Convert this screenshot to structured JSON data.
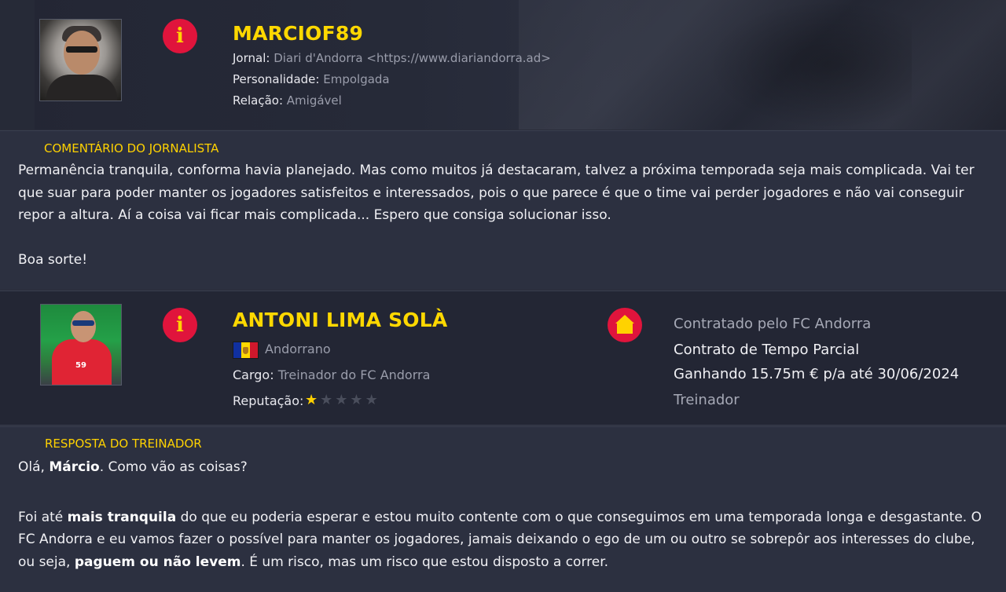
{
  "journalist": {
    "name": "MARCIOF89",
    "newspaper_label": "Jornal:",
    "newspaper_value": "Diari d'Andorra <https://www.diariandorra.ad>",
    "personality_label": "Personalidade:",
    "personality_value": "Empolgada",
    "relation_label": "Relação:",
    "relation_value": "Amigável"
  },
  "journalist_comment": {
    "heading": "COMENTÁRIO DO JORNALISTA",
    "line1": "Permanência tranquila, conforma havia planejado. Mas como muitos já destacaram, talvez a próxima temporada seja mais complicada. Vai ter",
    "line2": "que suar para poder manter os jogadores satisfeitos e interessados, pois o que parece é que o time vai perder jogadores e não vai conseguir",
    "line3": "repor a altura. Aí a coisa vai ficar mais complicada... Espero que consiga solucionar isso.",
    "line4": "Boa sorte!"
  },
  "coach": {
    "name": "ANTONI LIMA SOLÀ",
    "nationality": "Andorrano",
    "role_label": "Cargo:",
    "role_value": "Treinador do FC Andorra",
    "reputation_label": "Reputação:",
    "reputation_stars": 1,
    "reputation_max": 5,
    "contract_club": "Contratado pelo FC Andorra",
    "contract_type": "Contrato de Tempo Parcial",
    "contract_salary": "Ganhando 15.75m € p/a até 30/06/2024",
    "contract_role": "Treinador"
  },
  "coach_reply": {
    "heading": "RESPOSTA DO TREINADOR",
    "greet_pre": "Olá, ",
    "greet_bold": "Márcio",
    "greet_post": ". Como vão as coisas?",
    "p1_pre": "Foi até ",
    "p1_bold": "mais tranquila",
    "p1_post": " do que eu poderia esperar e estou muito contente com o que conseguimos em uma temporada longa e desgastante. O",
    "p2": "FC Andorra e eu vamos fazer o possível para manter os jogadores, jamais deixando o ego de um ou outro se sobrepôr aos interesses do clube,",
    "p3_pre": "ou seja, ",
    "p3_bold": "paguem ou não levem",
    "p3_post": ". É um risco, mas um risco que estou disposto a correr."
  },
  "colors": {
    "accent_yellow": "#ffd800",
    "badge_red": "#e0143c",
    "panel_bg": "#2c3040",
    "header_bg": "#232634"
  },
  "icons": {
    "journalist_badge": "info-icon",
    "coach_badge": "info-icon",
    "contract_badge": "home-icon",
    "reputation": "star-icon"
  }
}
